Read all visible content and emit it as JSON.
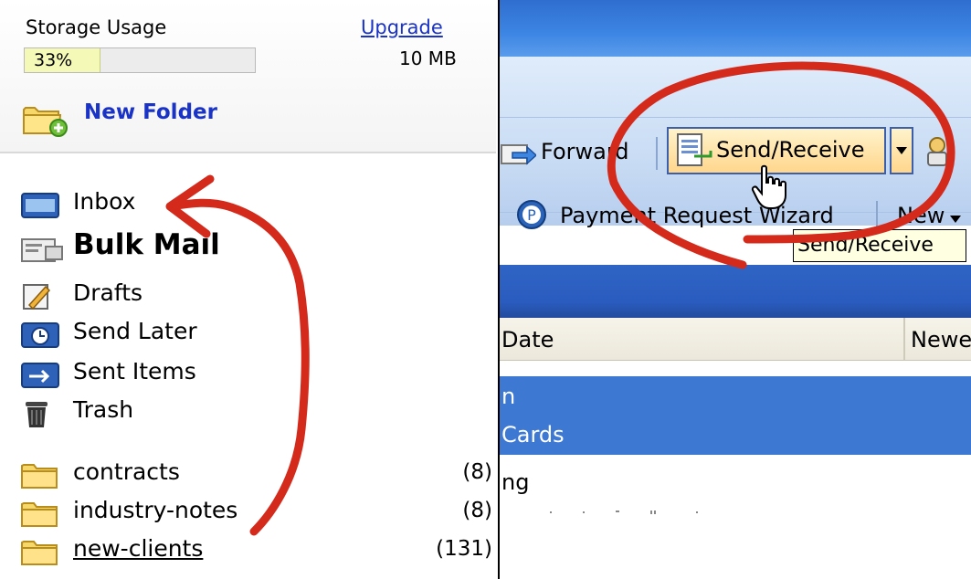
{
  "storage": {
    "label": "Storage Usage",
    "upgrade_link": "Upgrade",
    "percent_text": "33%",
    "fraction_used": 0.33,
    "size_text": "10 MB",
    "new_folder_label": "New Folder"
  },
  "folders": {
    "system": [
      {
        "label": "Inbox",
        "icon": "inbox-folder-icon"
      },
      {
        "label": "Bulk Mail",
        "icon": "bulk-mail-icon"
      },
      {
        "label": "Drafts",
        "icon": "drafts-icon"
      },
      {
        "label": "Send Later",
        "icon": "send-later-icon"
      },
      {
        "label": "Sent Items",
        "icon": "sent-items-icon"
      },
      {
        "label": "Trash",
        "icon": "trash-icon"
      }
    ],
    "user": [
      {
        "label": "contracts",
        "count": "(8)"
      },
      {
        "label": "industry-notes",
        "count": "(8)"
      },
      {
        "label": "new-clients",
        "count": "(131)"
      }
    ]
  },
  "toolbar": {
    "forward_label": "Forward",
    "send_receive_label": "Send/Receive",
    "payment_request_label": "Payment Request Wizard",
    "new_label": "New",
    "tooltip_text": "Send/Receive"
  },
  "message_list": {
    "columns": [
      "Date",
      "Newest"
    ],
    "rows": [
      {
        "text": "n",
        "selected": true
      },
      {
        "text": "Cards",
        "selected": true
      },
      {
        "text": "ng",
        "selected": false
      }
    ]
  },
  "colors": {
    "annotation_red": "#d42a1c",
    "link_blue": "#1a33c7",
    "selection_blue": "#3d78d3"
  }
}
